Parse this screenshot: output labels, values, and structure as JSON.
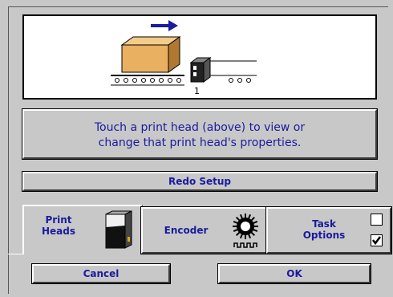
{
  "picture": {
    "head_number": "1"
  },
  "message": {
    "line1": "Touch a print head (above) to view or",
    "line2": "change that print head's properties."
  },
  "buttons": {
    "redo_setup": "Redo Setup",
    "cancel": "Cancel",
    "ok": "OK"
  },
  "tabs": {
    "print_heads_line1": "Print",
    "print_heads_line2": "Heads",
    "encoder": "Encoder",
    "task_options_line1": "Task",
    "task_options_line2": "Options"
  },
  "checkboxes": {
    "top_checked": false,
    "bottom_checked": true
  },
  "colors": {
    "label_text": "#1a1aa0",
    "arrow": "#1a1aa0",
    "box_fill": "#e8b060"
  },
  "icons": [
    "direction-arrow-icon",
    "box-icon",
    "print-head-icon",
    "conveyor-icon",
    "encoder-icon",
    "checkmark-icon"
  ]
}
